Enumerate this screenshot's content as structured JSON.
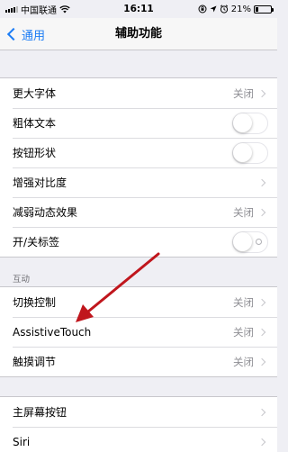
{
  "status_bar": {
    "carrier": "中国联通",
    "time": "16:11",
    "battery": "21%",
    "battery_level": 0.21
  },
  "nav": {
    "back_label": "通用",
    "title": "辅助功能"
  },
  "group1": {
    "larger_text": {
      "label": "更大字体",
      "value": "关闭"
    },
    "bold_text": {
      "label": "粗体文本",
      "state": "off"
    },
    "button_shapes": {
      "label": "按钮形状",
      "state": "off"
    },
    "increase_contrast": {
      "label": "增强对比度"
    },
    "reduce_motion": {
      "label": "减弱动态效果",
      "value": "关闭"
    },
    "on_off_labels": {
      "label": "开/关标签",
      "state": "off"
    }
  },
  "interaction": {
    "header": "互动",
    "switch_control": {
      "label": "切换控制",
      "value": "关闭"
    },
    "assistive_touch": {
      "label": "AssistiveTouch",
      "value": "关闭"
    },
    "touch_accommodations": {
      "label": "触摸调节",
      "value": "关闭"
    }
  },
  "group3": {
    "home_button": {
      "label": "主屏幕按钮"
    },
    "siri": {
      "label": "Siri"
    }
  },
  "colors": {
    "accent": "#1b7cf5",
    "annotation_arrow": "#c0161d"
  }
}
